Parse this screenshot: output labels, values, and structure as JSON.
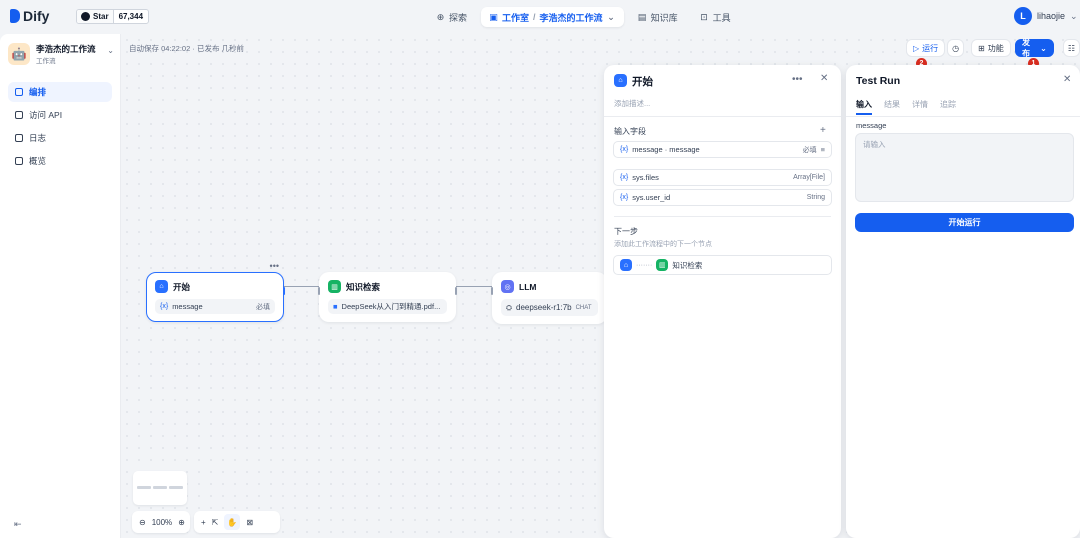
{
  "header": {
    "logo_text": "Dify",
    "github_star_label": "Star",
    "github_star_count": "67,344",
    "nav": {
      "explore": "探索",
      "studio": "工作室",
      "app_name": "李浩杰的工作流",
      "knowledge": "知识库",
      "tools": "工具"
    },
    "user_initial": "L",
    "user_name": "lihaojie"
  },
  "sidebar": {
    "app_name": "李浩杰的工作流",
    "app_type": "工作流",
    "items": [
      {
        "label": "编排",
        "icon": "orchestrate-icon",
        "active": true
      },
      {
        "label": "访问 API",
        "icon": "api-icon",
        "active": false
      },
      {
        "label": "日志",
        "icon": "logs-icon",
        "active": false
      },
      {
        "label": "概览",
        "icon": "overview-icon",
        "active": false
      }
    ]
  },
  "canvas": {
    "autosave_text": "自动保存 04:22:02 · 已发布 几秒前",
    "toolbar": {
      "run_label": "运行",
      "features_label": "功能",
      "publish_label": "发布",
      "badge_run": "2",
      "badge_publish": "1"
    },
    "nodes": {
      "start": {
        "title": "开始",
        "var_name": "message",
        "required": "必填"
      },
      "knowledge": {
        "title": "知识检索",
        "dataset": "DeepSeek从入门到精通.pdf..."
      },
      "llm": {
        "title": "LLM",
        "model": "deepseek-r1:7b",
        "mode": "CHAT"
      }
    },
    "zoom": "100%"
  },
  "start_panel": {
    "title": "开始",
    "description_placeholder": "添加描述...",
    "input_fields_label": "输入字段",
    "fields": [
      {
        "name": "message · message",
        "right": "必填"
      },
      {
        "name": "sys.files",
        "right": "Array[File]"
      },
      {
        "name": "sys.user_id",
        "right": "String"
      }
    ],
    "next_step_label": "下一步",
    "next_step_desc": "添加此工作流程中的下一个节点",
    "next_node": "知识检索"
  },
  "test_run": {
    "title": "Test Run",
    "tabs": [
      "输入",
      "结果",
      "详情",
      "追踪"
    ],
    "field_label": "message",
    "placeholder": "请输入",
    "run_button": "开始运行"
  },
  "colors": {
    "accent": "#155eef",
    "badge": "#d92d20",
    "green": "#16b364"
  }
}
